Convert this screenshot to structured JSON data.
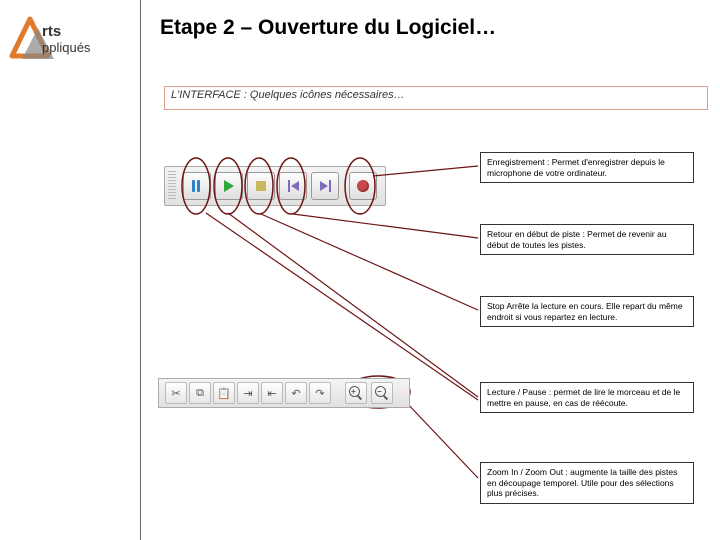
{
  "logo": {
    "line1": "rts",
    "line2": "ppliqués"
  },
  "title": "Etape 2 – Ouverture du Logiciel…",
  "subtitle": "L'INTERFACE : Quelques icônes nécessaires…",
  "callouts": {
    "rec": "Enregistrement : Permet d'enregistrer depuis le microphone de votre ordinateur.",
    "start": "Retour en début de piste : Permet de revenir au début de toutes les pistes.",
    "stop": "Stop Arrête la lecture en cours. Elle repart du même endroit si vous repartez en lecture.",
    "play": "Lecture / Pause :  permet de lire le morceau et de le mettre en pause, en cas de réécoute.",
    "zoom": "Zoom In / Zoom Out : augmente la taille des pistes en découpage temporel. Utile pour des sélections plus précises."
  }
}
